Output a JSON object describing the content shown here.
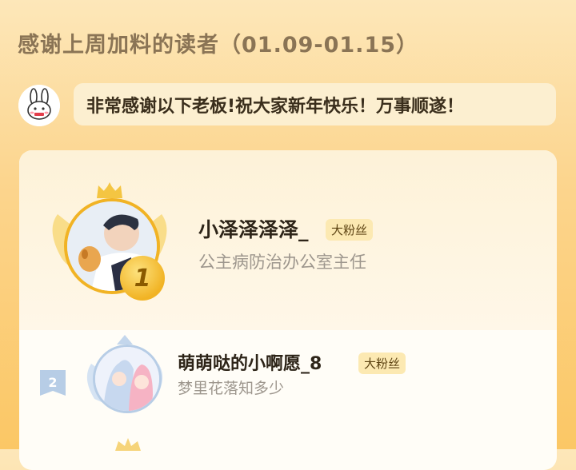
{
  "header": {
    "title": "感谢上周加料的读者（01.09-01.15）",
    "banner_text": "非常感谢以下老板!祝大家新年快乐！万事顺遂！"
  },
  "readers": [
    {
      "rank": "1",
      "name": "小泽泽泽泽_",
      "badge": "大粉丝",
      "title": "公主病防治办公室主任"
    },
    {
      "rank": "2",
      "name": "萌萌哒的小啊愿_8",
      "badge": "大粉丝",
      "title": "梦里花落知多少"
    }
  ],
  "colors": {
    "gold": "#f1b324",
    "silver": "#b7cde6",
    "accent_bg": "#fce9b2"
  }
}
